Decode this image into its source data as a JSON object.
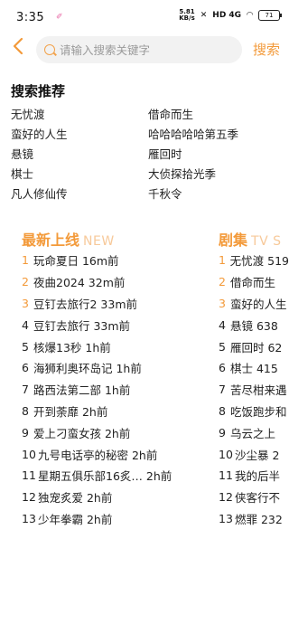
{
  "status": {
    "time": "3:35",
    "speed_top": "5.81",
    "speed_unit": "KB/s",
    "signal": "HD 4G",
    "battery": "71"
  },
  "search": {
    "placeholder": "请输入搜索关键字",
    "button_label": "搜索"
  },
  "recommend": {
    "title": "搜索推荐",
    "items": [
      "无忧渡",
      "借命而生",
      "蛮好的人生",
      "哈哈哈哈哈第五季",
      "悬镜",
      "雁回时",
      "棋士",
      "大侦探拾光季",
      "凡人修仙传",
      "千秋令"
    ]
  },
  "latest": {
    "title": "最新上线",
    "subtitle": "NEW",
    "items": [
      {
        "rank": "1",
        "text": "玩命夏日 16m前"
      },
      {
        "rank": "2",
        "text": "夜曲2024 32m前"
      },
      {
        "rank": "3",
        "text": "豆钉去旅行2 33m前"
      },
      {
        "rank": "4",
        "text": "豆钉去旅行 33m前"
      },
      {
        "rank": "5",
        "text": "核爆13秒 1h前"
      },
      {
        "rank": "6",
        "text": "海狮利奥环岛记 1h前"
      },
      {
        "rank": "7",
        "text": "路西法第二部 1h前"
      },
      {
        "rank": "8",
        "text": "开到荼靡 2h前"
      },
      {
        "rank": "9",
        "text": "爱上刁蛮女孩 2h前"
      },
      {
        "rank": "10",
        "text": "九号电话亭的秘密 2h前"
      },
      {
        "rank": "11",
        "text": "星期五俱乐部16炙… 2h前"
      },
      {
        "rank": "12",
        "text": "独宠炙爱 2h前"
      },
      {
        "rank": "13",
        "text": "少年拳霸 2h前"
      }
    ]
  },
  "drama": {
    "title": "剧集",
    "subtitle": "TV S",
    "items": [
      {
        "rank": "1",
        "text": "无忧渡 519"
      },
      {
        "rank": "2",
        "text": "借命而生"
      },
      {
        "rank": "3",
        "text": "蛮好的人生"
      },
      {
        "rank": "4",
        "text": "悬镜 638"
      },
      {
        "rank": "5",
        "text": "雁回时 62"
      },
      {
        "rank": "6",
        "text": "棋士 415"
      },
      {
        "rank": "7",
        "text": "苦尽柑来遇"
      },
      {
        "rank": "8",
        "text": "吃饭跑步和"
      },
      {
        "rank": "9",
        "text": "乌云之上"
      },
      {
        "rank": "10",
        "text": "沙尘暴 2"
      },
      {
        "rank": "11",
        "text": "我的后半"
      },
      {
        "rank": "12",
        "text": "侠客行不"
      },
      {
        "rank": "13",
        "text": "燃罪 232"
      }
    ]
  },
  "colors": {
    "accent": "#f39a3a",
    "accent_light": "#f7c99a"
  }
}
